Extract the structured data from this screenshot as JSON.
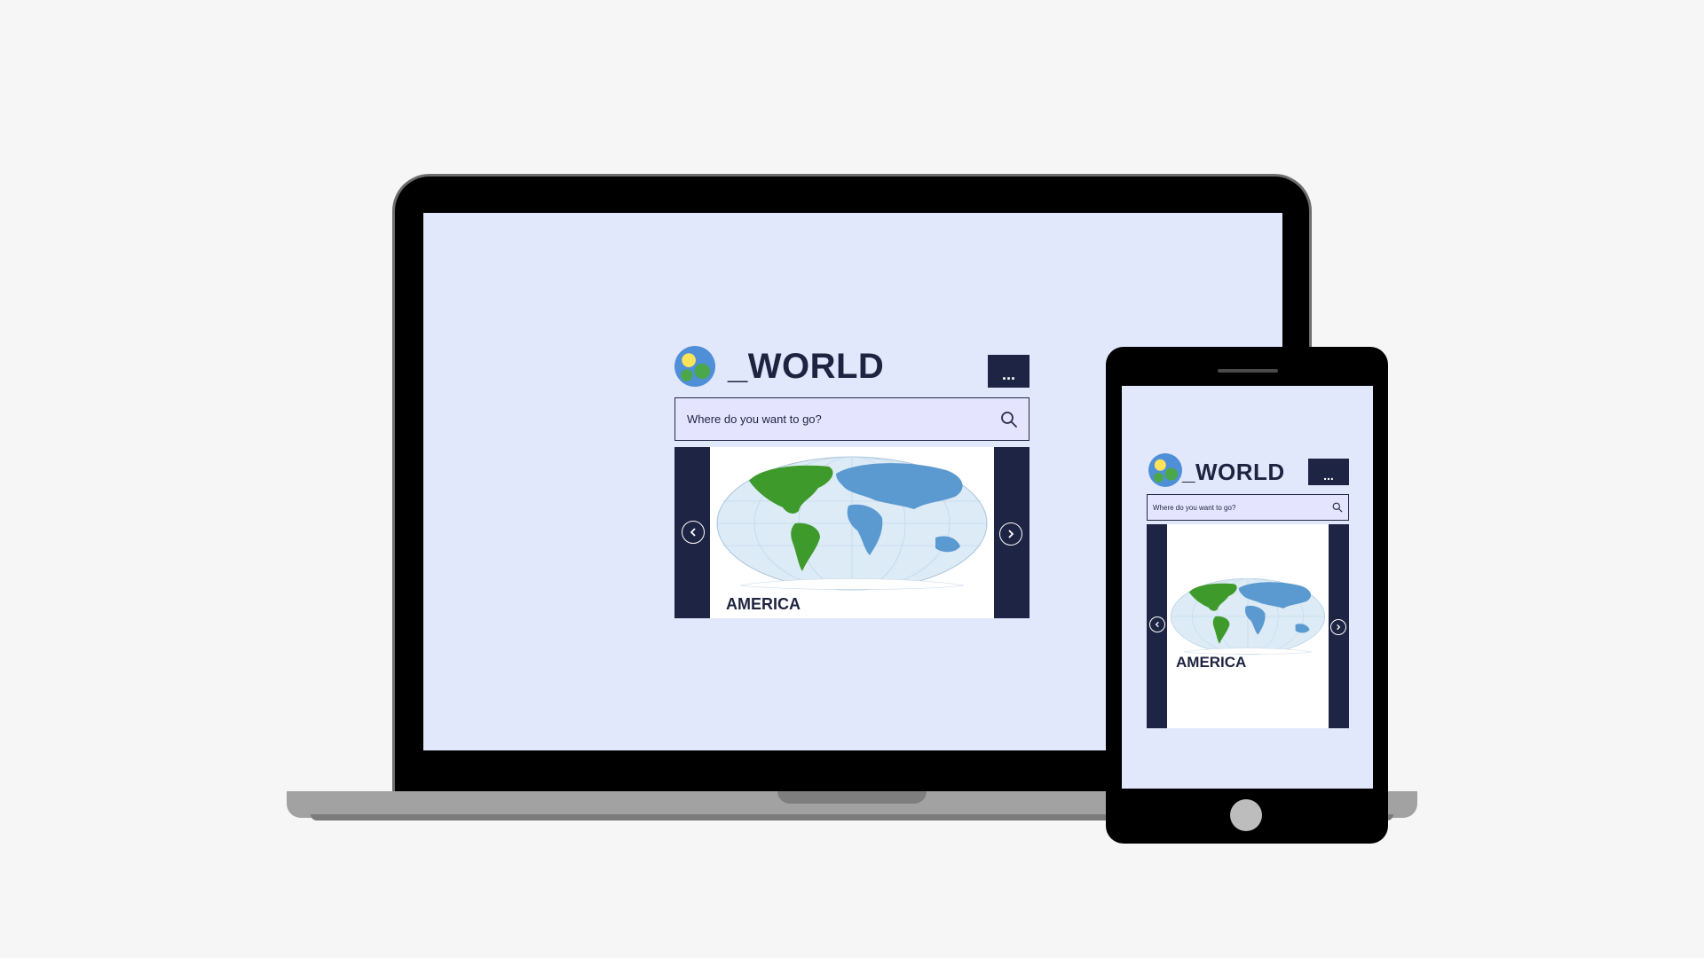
{
  "app": {
    "title": "_WORLD",
    "menu_label": "...",
    "search_placeholder": "Where do you want to go?",
    "slide_caption": "AMERICA"
  },
  "icons": {
    "logo": "globe-icon",
    "search": "search-icon",
    "prev": "chevron-left-icon",
    "next": "chevron-right-icon"
  },
  "colors": {
    "page_background": "#f6f6f6",
    "screen_background": "#e1e8fc",
    "navy": "#1e2444",
    "search_background": "#e4e4ff",
    "americas_green": "#3f9a2c",
    "continents_blue": "#5b9ad0",
    "ocean": "#dcebf6"
  }
}
